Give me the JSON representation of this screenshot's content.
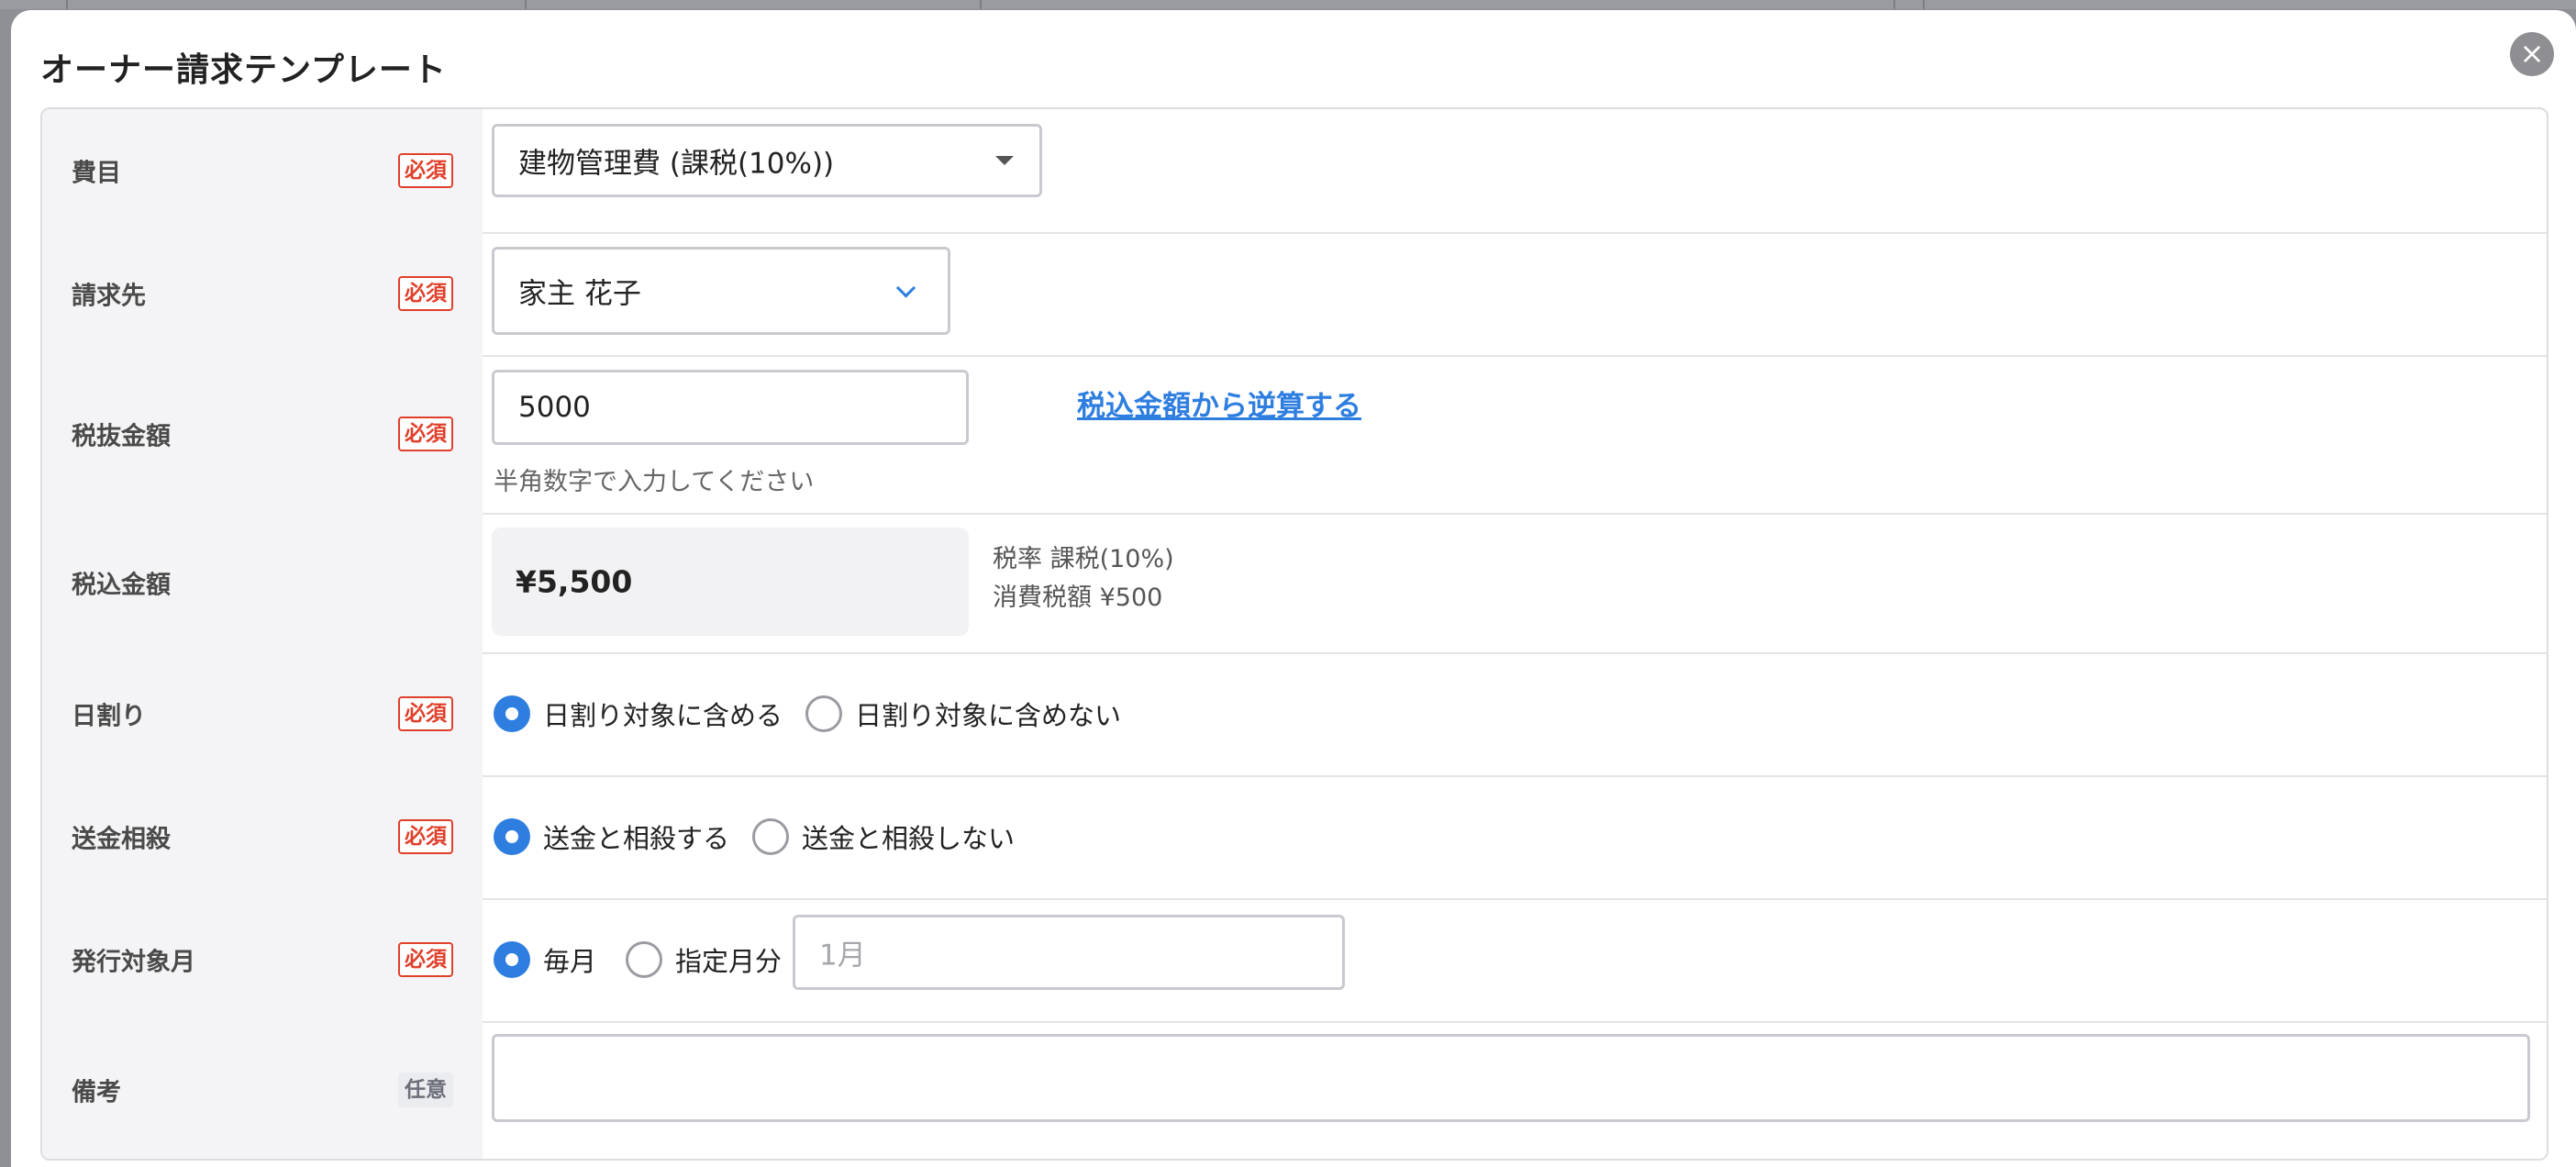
{
  "modal": {
    "title": "オーナー請求テンプレート",
    "close_icon": "close-icon",
    "close_glyph": "×"
  },
  "badges": {
    "required": "必須",
    "optional": "任意"
  },
  "fields": {
    "expense_item": {
      "label": "費目",
      "value": "建物管理費 (課税(10%))"
    },
    "billing_to": {
      "label": "請求先",
      "value": "家主 花子"
    },
    "amount_excl_tax": {
      "label": "税抜金額",
      "value": "5000",
      "helper": "半角数字で入力してください",
      "reverse_calc_link": "税込金額から逆算する"
    },
    "amount_incl_tax": {
      "label": "税込金額",
      "value": "¥5,500",
      "tax_rate": "税率 課税(10%)",
      "tax_amount": "消費税額 ¥500"
    },
    "proration": {
      "label": "日割り",
      "options": [
        "日割り対象に含める",
        "日割り対象に含めない"
      ],
      "selected": 0
    },
    "offset": {
      "label": "送金相殺",
      "options": [
        "送金と相殺する",
        "送金と相殺しない"
      ],
      "selected": 0
    },
    "issue_month": {
      "label": "発行対象月",
      "options": [
        "毎月",
        "指定月分"
      ],
      "selected": 0,
      "month_placeholder": "1月"
    },
    "remarks": {
      "label": "備考",
      "value": ""
    }
  },
  "colors": {
    "accent": "#2e7ee0",
    "required_badge": "#e0402b",
    "label_bg": "#f4f4f6"
  }
}
